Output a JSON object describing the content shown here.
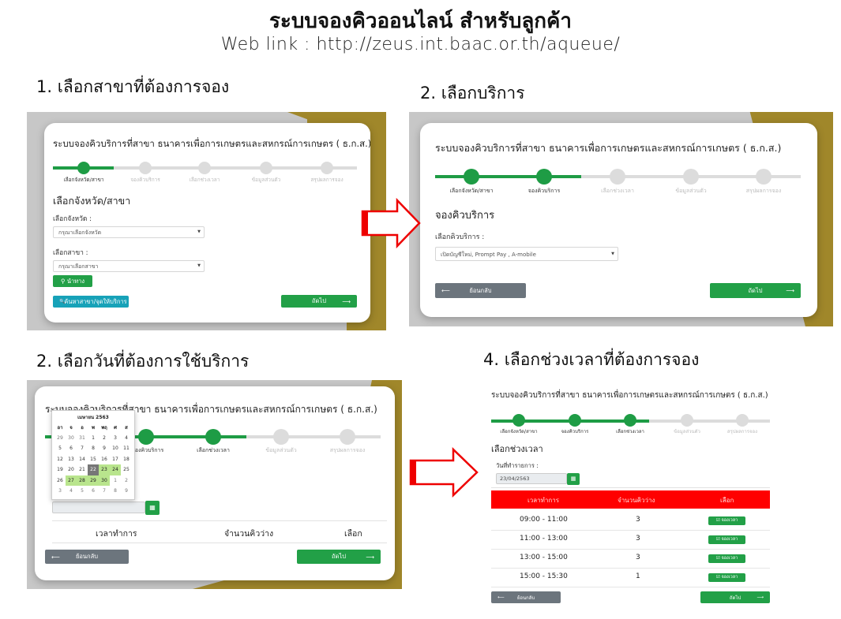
{
  "slide": {
    "title": "ระบบจองคิวออนไลน์  สำหรับลูกค้า",
    "link": "Web link : http://zeus.int.baac.or.th/aqueue/"
  },
  "common": {
    "card_title": "ระบบจองคิวบริการที่สาขา ธนาคารเพื่อการเกษตรและสหกรณ์การเกษตร ( ธ.ก.ส.)",
    "steps": [
      "เลือกจังหวัด/สาขา",
      "จองคิวบริการ",
      "เลือกช่วงเวลา",
      "ข้อมูลส่วนตัว",
      "สรุปผลการจอง"
    ],
    "back_label": "ย้อนกลับ",
    "next_label": "ถัดไป"
  },
  "panel1": {
    "heading": "1. เลือกสาขาที่ต้องการจอง",
    "section_title": "เลือกจังหวัด/สาขา",
    "province_label": "เลือกจังหวัด :",
    "province_placeholder": "กรุณาเลือกจังหวัด",
    "branch_label": "เลือกสาขา :",
    "branch_placeholder": "กรุณาเลือกสาขา",
    "nav_button": "นำทาง",
    "search_button": "ค้นหาสาขา/จุดให้บริการ"
  },
  "panel2": {
    "heading": "2. เลือกบริการ",
    "section_title": "จองคิวบริการ",
    "service_label": "เลือกคิวบริการ :",
    "service_value": "เปิดบัญชีใหม่, Prompt Pay , A-mobile"
  },
  "panel3": {
    "heading": "2. เลือกวันที่ต้องการใช้บริการ",
    "calendar": {
      "month": "เมษายน 2563",
      "weekdays": [
        "อา",
        "จ",
        "อ",
        "พ",
        "พฤ",
        "ศ",
        "ส"
      ],
      "weeks": [
        [
          "29",
          "30",
          "31",
          "1",
          "2",
          "3",
          "4"
        ],
        [
          "5",
          "6",
          "7",
          "8",
          "9",
          "10",
          "11"
        ],
        [
          "12",
          "13",
          "14",
          "15",
          "16",
          "17",
          "18"
        ],
        [
          "19",
          "20",
          "21",
          "22",
          "23",
          "24",
          "25"
        ],
        [
          "26",
          "27",
          "28",
          "29",
          "30",
          "1",
          "2"
        ],
        [
          "3",
          "4",
          "5",
          "6",
          "7",
          "8",
          "9"
        ]
      ],
      "selected": "22",
      "available": [
        "23",
        "24",
        "27",
        "28",
        "29",
        "30"
      ]
    },
    "col_time": "เวลาทำการ",
    "col_count": "จำนวนคิวว่าง",
    "col_select": "เลือก"
  },
  "panel4": {
    "heading": "4. เลือกช่วงเวลาที่ต้องการจอง",
    "section_title": "เลือกช่วงเวลา",
    "date_label": "วันที่ทำรายการ :",
    "date_value": "23/04/2563",
    "columns": [
      "เวลาทำการ",
      "จำนวนคิวว่าง",
      "เลือก"
    ],
    "book_label": "จองเวลา",
    "rows": [
      {
        "time": "09:00 - 11:00",
        "count": "3"
      },
      {
        "time": "11:00 - 13:00",
        "count": "3"
      },
      {
        "time": "13:00 - 15:00",
        "count": "3"
      },
      {
        "time": "15:00 - 15:30",
        "count": "1"
      }
    ]
  },
  "icons": {
    "check": "☑",
    "search": "🔍",
    "pin": "⚲",
    "calendar": "▦",
    "arrow_left": "⟵",
    "arrow_right": "⟶",
    "caret": "▼"
  },
  "colors": {
    "accent_green": "#22a047",
    "header_red": "#ff0000",
    "gold": "#a0872a",
    "teal": "#17a2b8",
    "grey": "#6c757d"
  }
}
